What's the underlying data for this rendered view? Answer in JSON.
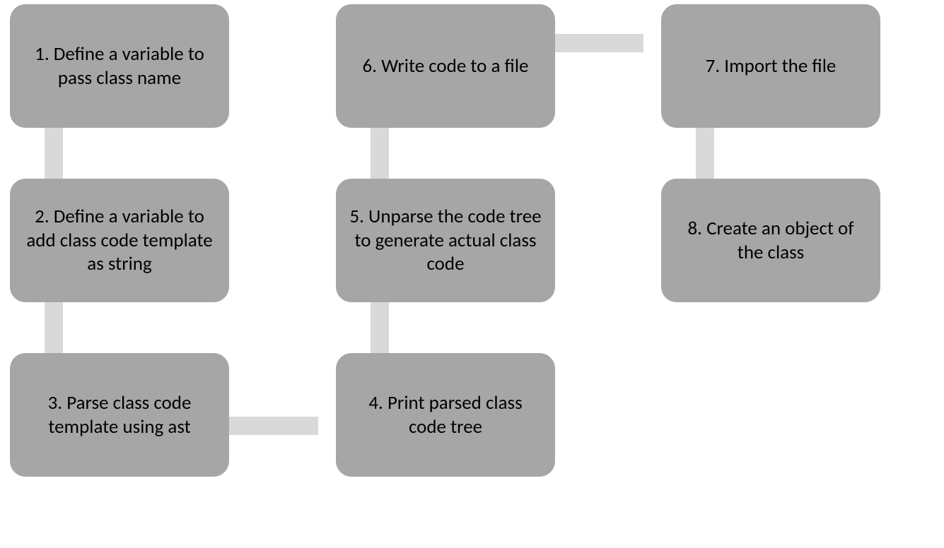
{
  "steps": {
    "s1": "1. Define a variable to pass class name",
    "s2": "2. Define a variable to add class code template as string",
    "s3": "3. Parse class code template using ast",
    "s4": "4. Print parsed class code tree",
    "s5": "5. Unparse the code tree to generate actual class code",
    "s6": "6. Write code to a file",
    "s7": "7. Import the file",
    "s8": "8. Create an object of the class"
  }
}
